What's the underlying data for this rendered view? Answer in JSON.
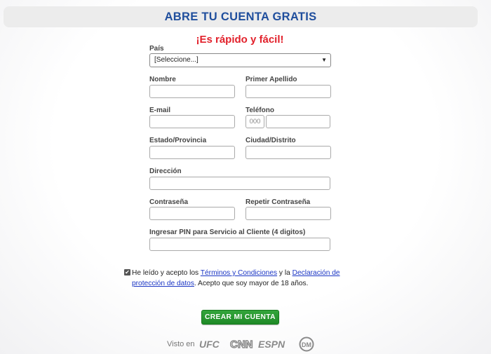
{
  "header": {
    "title": "ABRE TU CUENTA GRATIS"
  },
  "subtitle": "¡Es rápido y fácil!",
  "form": {
    "country": {
      "label": "País",
      "selected": "[Seleccione...]"
    },
    "first_name": {
      "label": "Nombre",
      "value": ""
    },
    "last_name": {
      "label": "Primer Apellido",
      "value": ""
    },
    "email": {
      "label": "E-mail",
      "value": ""
    },
    "phone": {
      "label": "Teléfono",
      "prefix_placeholder": "000",
      "value": ""
    },
    "state": {
      "label": "Estado/Provincia",
      "value": ""
    },
    "city": {
      "label": "Ciudad/Distrito",
      "value": ""
    },
    "address": {
      "label": "Dirección",
      "value": ""
    },
    "password": {
      "label": "Contraseña",
      "value": ""
    },
    "password_repeat": {
      "label": "Repetir Contraseña",
      "value": ""
    },
    "pin": {
      "label": "Ingresar PIN para Servicio al Cliente (4 digitos)",
      "value": ""
    }
  },
  "terms": {
    "checked": true,
    "prefix": "He leído y acepto los ",
    "terms_link": "Términos y Condiciones",
    "middle": " y la ",
    "privacy_link": "Declaración de protección de datos",
    "suffix": ". Acepto que soy mayor de 18 años."
  },
  "cta": {
    "label": "CREAR MI CUENTA",
    "color": "#2a9a32"
  },
  "seen_on": {
    "label": "Visto en",
    "logos": [
      "ufc-logo",
      "cnn-logo",
      "espn-logo",
      "dm-logo"
    ]
  },
  "colors": {
    "header_title": "#1f4e9d",
    "subtitle": "#e2212b",
    "link": "#1a35c4"
  }
}
